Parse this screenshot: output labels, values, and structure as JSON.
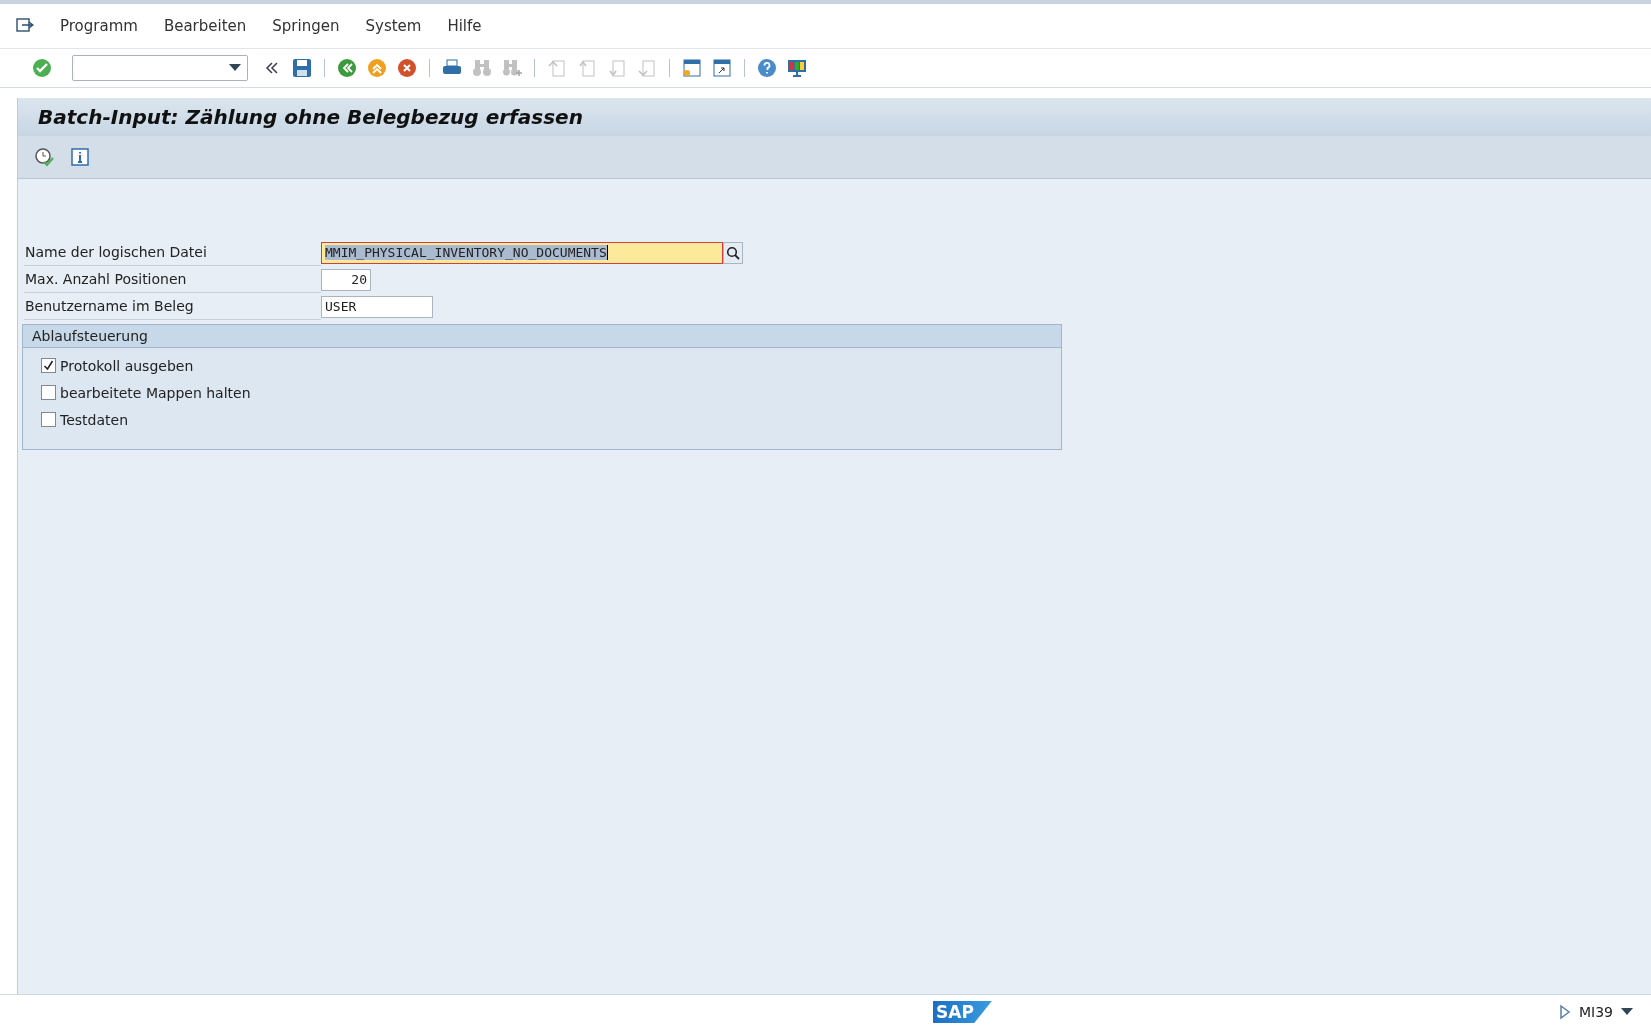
{
  "menu": [
    "Programm",
    "Bearbeiten",
    "Springen",
    "System",
    "Hilfe"
  ],
  "toolbar_buttons": [
    {
      "disabled": false
    },
    {
      "disabled": false
    },
    {
      "disabled": false
    },
    {
      "disabled": false
    },
    {
      "disabled": false
    },
    {
      "disabled": false
    },
    {
      "disabled": true
    },
    {
      "disabled": true
    },
    {
      "disabled": true
    },
    {
      "disabled": true
    },
    {
      "disabled": true
    },
    {
      "disabled": true
    },
    {
      "disabled": false
    },
    {
      "disabled": false
    },
    {
      "disabled": false
    },
    {
      "disabled": false
    }
  ],
  "title": "Batch-Input: Zählung ohne Belegbezug erfassen",
  "fields": [
    {
      "label": "Name der logischen Datei",
      "value": "MMIM_PHYSICAL_INVENTORY_NO_DOCUMENTS",
      "kind": "search",
      "focused": true
    },
    {
      "label": "Max. Anzahl Positionen",
      "value": "20",
      "kind": "number",
      "focused": false
    },
    {
      "label": "Benutzername im Beleg",
      "value": "USER",
      "kind": "text",
      "focused": false
    }
  ],
  "group": {
    "title": "Ablaufsteuerung",
    "options": [
      {
        "label": "Protokoll ausgeben",
        "checked": true
      },
      {
        "label": "bearbeitete Mappen halten",
        "checked": false
      },
      {
        "label": "Testdaten",
        "checked": false
      }
    ]
  },
  "status_bar": {
    "logo": "SAP",
    "transaction": "MI39"
  }
}
